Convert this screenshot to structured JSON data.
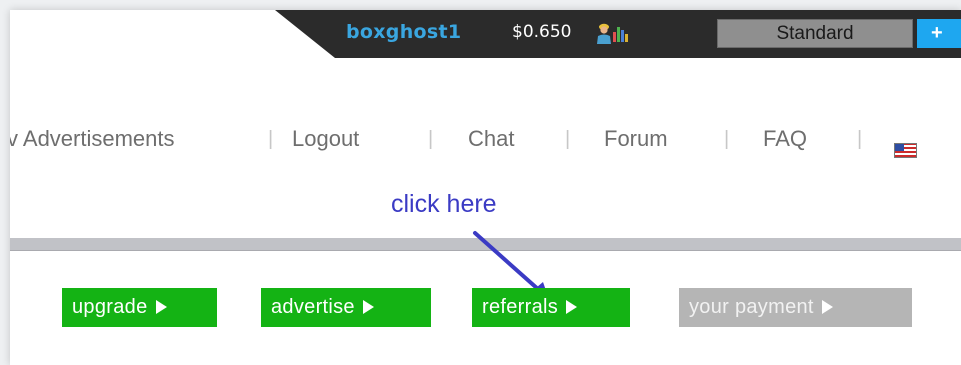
{
  "header": {
    "username": "boxghost1",
    "balance": "$0.650",
    "membership_label": "Standard",
    "plus_label": "+",
    "icons": [
      "person-icon",
      "bar-chart-icon"
    ]
  },
  "nav": {
    "items": [
      {
        "label": "v Advertisements"
      },
      {
        "label": "Logout"
      },
      {
        "label": "Chat"
      },
      {
        "label": "Forum"
      },
      {
        "label": "FAQ"
      }
    ],
    "separator": "|",
    "flag": "us-flag-icon"
  },
  "annotation": {
    "text": "click here",
    "color": "#3b3bc4"
  },
  "actions": [
    {
      "label": "upgrade",
      "color": "#14b314"
    },
    {
      "label": "advertise",
      "color": "#14b314"
    },
    {
      "label": "referrals",
      "color": "#14b314"
    },
    {
      "label": "your payment",
      "color": "#b5b5b5"
    }
  ],
  "colors": {
    "topbar": "#2b2b2b",
    "username": "#3aa6e0",
    "accent_blue": "#1ea7f0",
    "button_green": "#14b314"
  }
}
